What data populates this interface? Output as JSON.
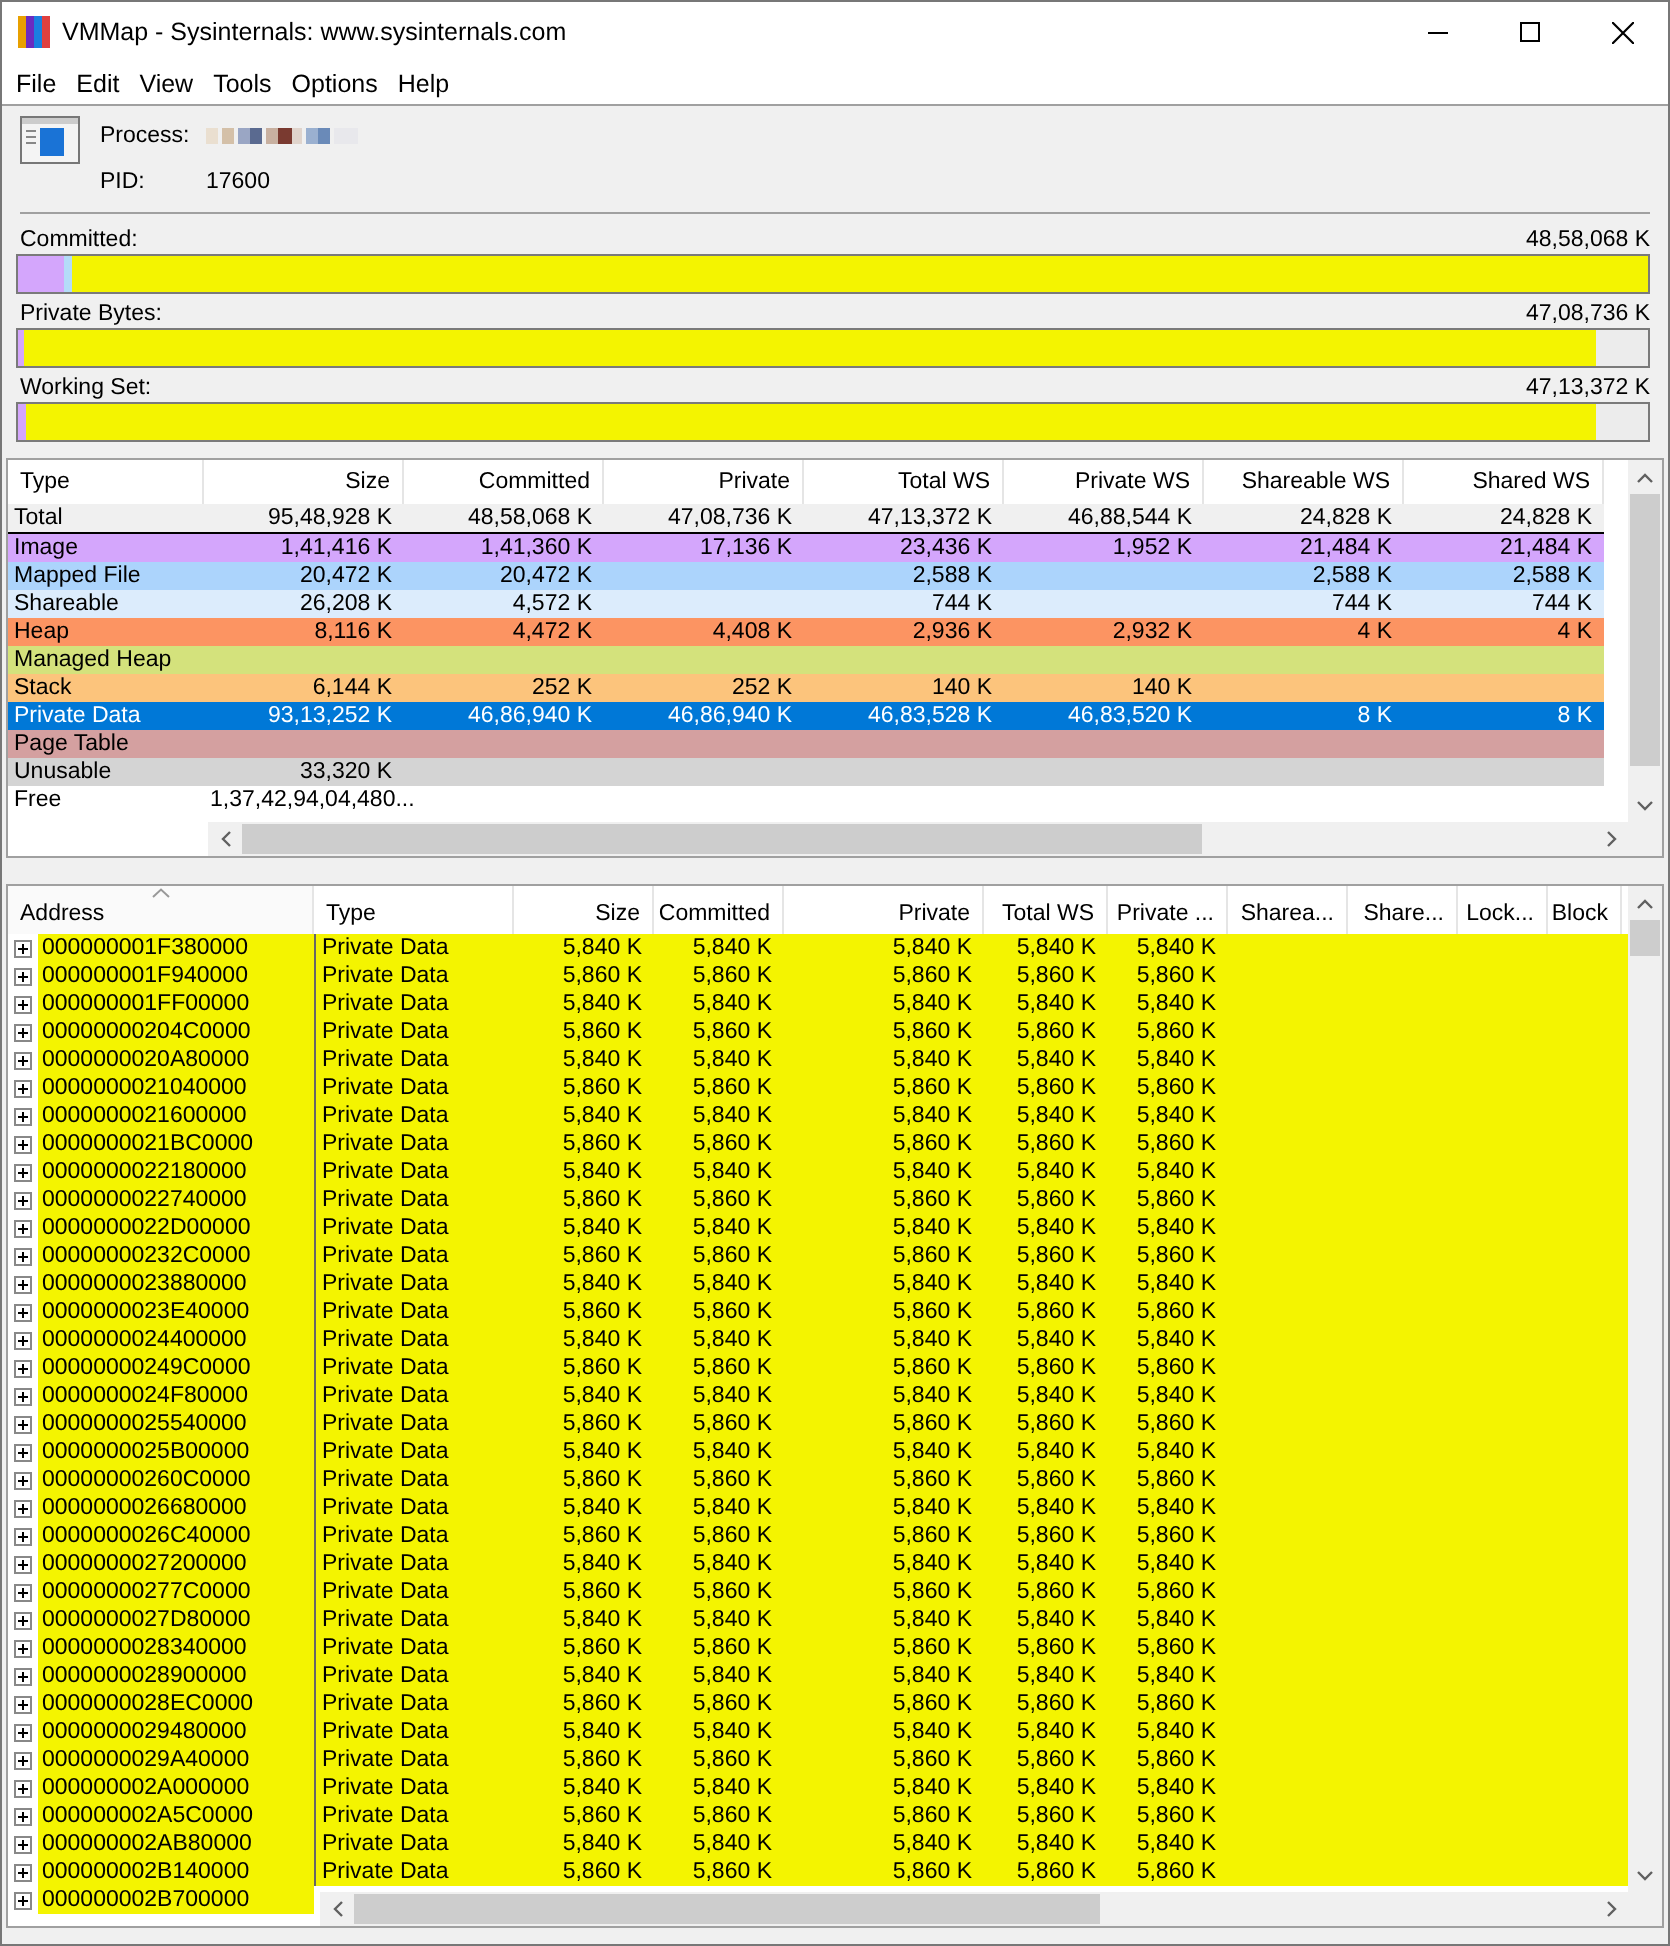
{
  "window": {
    "title": "VMMap - Sysinternals: www.sysinternals.com"
  },
  "menu": [
    "File",
    "Edit",
    "View",
    "Tools",
    "Options",
    "Help"
  ],
  "process": {
    "process_label": "Process:",
    "pid_label": "PID:",
    "pid": "17600"
  },
  "meters": [
    {
      "label": "Committed:",
      "value": "48,58,068 K",
      "segments": [
        {
          "color": "#d4a6fc",
          "level": 0.028
        },
        {
          "color": "#b4dcf8",
          "level": 0.005
        },
        {
          "color": "#f4f400",
          "level": 0.967
        }
      ]
    },
    {
      "label": "Private Bytes:",
      "value": "47,08,736 K",
      "segments": [
        {
          "color": "#d4a6fc",
          "level": 0.004
        },
        {
          "color": "#f4f400",
          "level": 0.964
        }
      ]
    },
    {
      "label": "Working Set:",
      "value": "47,13,372 K",
      "segments": [
        {
          "color": "#d4a6fc",
          "level": 0.005
        },
        {
          "color": "#f4f400",
          "level": 0.963
        }
      ]
    }
  ],
  "summary_table": {
    "columns": [
      "Type",
      "Size",
      "Committed",
      "Private",
      "Total WS",
      "Private WS",
      "Shareable WS",
      "Shared WS"
    ],
    "rows": [
      {
        "kind": "total",
        "type": "Total",
        "selected": false,
        "size": "95,48,928 K",
        "committed": "48,58,068 K",
        "private": "47,08,736 K",
        "total_ws": "47,13,372 K",
        "private_ws": "46,88,544 K",
        "shareable_ws": "24,828 K",
        "shared_ws": "24,828 K"
      },
      {
        "kind": "type",
        "type": "Image",
        "color": "#d4a6fc",
        "selected": false,
        "size": "1,41,416 K",
        "committed": "1,41,360 K",
        "private": "17,136 K",
        "total_ws": "23,436 K",
        "private_ws": "1,952 K",
        "shareable_ws": "21,484 K",
        "shared_ws": "21,484 K"
      },
      {
        "kind": "type",
        "type": "Mapped File",
        "color": "#acd4fc",
        "selected": false,
        "size": "20,472 K",
        "committed": "20,472 K",
        "total_ws": "2,588 K",
        "shareable_ws": "2,588 K",
        "shared_ws": "2,588 K"
      },
      {
        "kind": "type",
        "type": "Shareable",
        "color": "#dcecfc",
        "selected": false,
        "size": "26,208 K",
        "committed": "4,572 K",
        "total_ws": "744 K",
        "shareable_ws": "744 K",
        "shared_ws": "744 K"
      },
      {
        "kind": "type",
        "type": "Heap",
        "color": "#fc9462",
        "selected": false,
        "size": "8,116 K",
        "committed": "4,472 K",
        "private": "4,408 K",
        "total_ws": "2,936 K",
        "private_ws": "2,932 K",
        "shareable_ws": "4 K",
        "shared_ws": "4 K"
      },
      {
        "kind": "type",
        "type": "Managed Heap",
        "color": "#d4e27c",
        "selected": false
      },
      {
        "kind": "type",
        "type": "Stack",
        "color": "#fcc47c",
        "selected": false,
        "size": "6,144 K",
        "committed": "252 K",
        "private": "252 K",
        "total_ws": "140 K",
        "private_ws": "140 K"
      },
      {
        "kind": "type",
        "type": "Private Data",
        "selected": true,
        "size": "93,13,252 K",
        "committed": "46,86,940 K",
        "private": "46,86,940 K",
        "total_ws": "46,83,528 K",
        "private_ws": "46,83,520 K",
        "shareable_ws": "8 K",
        "shared_ws": "8 K"
      },
      {
        "kind": "type",
        "type": "Page Table",
        "color": "#d4a0a0",
        "selected": false
      },
      {
        "kind": "type",
        "type": "Unusable",
        "color": "#d4d4d4",
        "selected": false,
        "size": "33,320 K"
      },
      {
        "kind": "free",
        "type": "Free",
        "selected": false,
        "size": "1,37,42,94,04,480..."
      }
    ]
  },
  "detail_table": {
    "columns": [
      {
        "label": "Address",
        "sorted": true
      },
      {
        "label": "Type",
        "sorted": false
      },
      {
        "label": "Size",
        "sorted": false
      },
      {
        "label": "Committed",
        "sorted": false
      },
      {
        "label": "Private",
        "sorted": false
      },
      {
        "label": "Total WS",
        "sorted": false
      },
      {
        "label": "Private ...",
        "sorted": false
      },
      {
        "label": "Sharea...",
        "sorted": false
      },
      {
        "label": "Share...",
        "sorted": false
      },
      {
        "label": "Lock...",
        "sorted": false
      },
      {
        "label": "Block",
        "sorted": false
      }
    ],
    "rows": [
      {
        "address": "000000001F380000",
        "expanded": false,
        "type": "Private Data",
        "values": [
          "5,840 K",
          "5,840 K",
          "5,840 K",
          "5,840 K",
          "5,840 K"
        ]
      },
      {
        "address": "000000001F940000",
        "expanded": false,
        "type": "Private Data",
        "values": [
          "5,860 K",
          "5,860 K",
          "5,860 K",
          "5,860 K",
          "5,860 K"
        ]
      },
      {
        "address": "000000001FF00000",
        "expanded": false,
        "type": "Private Data",
        "values": [
          "5,840 K",
          "5,840 K",
          "5,840 K",
          "5,840 K",
          "5,840 K"
        ]
      },
      {
        "address": "00000000204C0000",
        "expanded": false,
        "type": "Private Data",
        "values": [
          "5,860 K",
          "5,860 K",
          "5,860 K",
          "5,860 K",
          "5,860 K"
        ]
      },
      {
        "address": "0000000020A80000",
        "expanded": false,
        "type": "Private Data",
        "values": [
          "5,840 K",
          "5,840 K",
          "5,840 K",
          "5,840 K",
          "5,840 K"
        ]
      },
      {
        "address": "0000000021040000",
        "expanded": false,
        "type": "Private Data",
        "values": [
          "5,860 K",
          "5,860 K",
          "5,860 K",
          "5,860 K",
          "5,860 K"
        ]
      },
      {
        "address": "0000000021600000",
        "expanded": false,
        "type": "Private Data",
        "values": [
          "5,840 K",
          "5,840 K",
          "5,840 K",
          "5,840 K",
          "5,840 K"
        ]
      },
      {
        "address": "0000000021BC0000",
        "expanded": false,
        "type": "Private Data",
        "values": [
          "5,860 K",
          "5,860 K",
          "5,860 K",
          "5,860 K",
          "5,860 K"
        ]
      },
      {
        "address": "0000000022180000",
        "expanded": false,
        "type": "Private Data",
        "values": [
          "5,840 K",
          "5,840 K",
          "5,840 K",
          "5,840 K",
          "5,840 K"
        ]
      },
      {
        "address": "0000000022740000",
        "expanded": false,
        "type": "Private Data",
        "values": [
          "5,860 K",
          "5,860 K",
          "5,860 K",
          "5,860 K",
          "5,860 K"
        ]
      },
      {
        "address": "0000000022D00000",
        "expanded": false,
        "type": "Private Data",
        "values": [
          "5,840 K",
          "5,840 K",
          "5,840 K",
          "5,840 K",
          "5,840 K"
        ]
      },
      {
        "address": "00000000232C0000",
        "expanded": false,
        "type": "Private Data",
        "values": [
          "5,860 K",
          "5,860 K",
          "5,860 K",
          "5,860 K",
          "5,860 K"
        ]
      },
      {
        "address": "0000000023880000",
        "expanded": false,
        "type": "Private Data",
        "values": [
          "5,840 K",
          "5,840 K",
          "5,840 K",
          "5,840 K",
          "5,840 K"
        ]
      },
      {
        "address": "0000000023E40000",
        "expanded": false,
        "type": "Private Data",
        "values": [
          "5,860 K",
          "5,860 K",
          "5,860 K",
          "5,860 K",
          "5,860 K"
        ]
      },
      {
        "address": "0000000024400000",
        "expanded": false,
        "type": "Private Data",
        "values": [
          "5,840 K",
          "5,840 K",
          "5,840 K",
          "5,840 K",
          "5,840 K"
        ]
      },
      {
        "address": "00000000249C0000",
        "expanded": false,
        "type": "Private Data",
        "values": [
          "5,860 K",
          "5,860 K",
          "5,860 K",
          "5,860 K",
          "5,860 K"
        ]
      },
      {
        "address": "0000000024F80000",
        "expanded": false,
        "type": "Private Data",
        "values": [
          "5,840 K",
          "5,840 K",
          "5,840 K",
          "5,840 K",
          "5,840 K"
        ]
      },
      {
        "address": "0000000025540000",
        "expanded": false,
        "type": "Private Data",
        "values": [
          "5,860 K",
          "5,860 K",
          "5,860 K",
          "5,860 K",
          "5,860 K"
        ]
      },
      {
        "address": "0000000025B00000",
        "expanded": false,
        "type": "Private Data",
        "values": [
          "5,840 K",
          "5,840 K",
          "5,840 K",
          "5,840 K",
          "5,840 K"
        ]
      },
      {
        "address": "00000000260C0000",
        "expanded": false,
        "type": "Private Data",
        "values": [
          "5,860 K",
          "5,860 K",
          "5,860 K",
          "5,860 K",
          "5,860 K"
        ]
      },
      {
        "address": "0000000026680000",
        "expanded": false,
        "type": "Private Data",
        "values": [
          "5,840 K",
          "5,840 K",
          "5,840 K",
          "5,840 K",
          "5,840 K"
        ]
      },
      {
        "address": "0000000026C40000",
        "expanded": false,
        "type": "Private Data",
        "values": [
          "5,860 K",
          "5,860 K",
          "5,860 K",
          "5,860 K",
          "5,860 K"
        ]
      },
      {
        "address": "0000000027200000",
        "expanded": false,
        "type": "Private Data",
        "values": [
          "5,840 K",
          "5,840 K",
          "5,840 K",
          "5,840 K",
          "5,840 K"
        ]
      },
      {
        "address": "00000000277C0000",
        "expanded": false,
        "type": "Private Data",
        "values": [
          "5,860 K",
          "5,860 K",
          "5,860 K",
          "5,860 K",
          "5,860 K"
        ]
      },
      {
        "address": "0000000027D80000",
        "expanded": false,
        "type": "Private Data",
        "values": [
          "5,840 K",
          "5,840 K",
          "5,840 K",
          "5,840 K",
          "5,840 K"
        ]
      },
      {
        "address": "0000000028340000",
        "expanded": false,
        "type": "Private Data",
        "values": [
          "5,860 K",
          "5,860 K",
          "5,860 K",
          "5,860 K",
          "5,860 K"
        ]
      },
      {
        "address": "0000000028900000",
        "expanded": false,
        "type": "Private Data",
        "values": [
          "5,840 K",
          "5,840 K",
          "5,840 K",
          "5,840 K",
          "5,840 K"
        ]
      },
      {
        "address": "0000000028EC0000",
        "expanded": false,
        "type": "Private Data",
        "values": [
          "5,860 K",
          "5,860 K",
          "5,860 K",
          "5,860 K",
          "5,860 K"
        ]
      },
      {
        "address": "0000000029480000",
        "expanded": false,
        "type": "Private Data",
        "values": [
          "5,840 K",
          "5,840 K",
          "5,840 K",
          "5,840 K",
          "5,840 K"
        ]
      },
      {
        "address": "0000000029A40000",
        "expanded": false,
        "type": "Private Data",
        "values": [
          "5,860 K",
          "5,860 K",
          "5,860 K",
          "5,860 K",
          "5,860 K"
        ]
      },
      {
        "address": "000000002A000000",
        "expanded": false,
        "type": "Private Data",
        "values": [
          "5,840 K",
          "5,840 K",
          "5,840 K",
          "5,840 K",
          "5,840 K"
        ]
      },
      {
        "address": "000000002A5C0000",
        "expanded": false,
        "type": "Private Data",
        "values": [
          "5,860 K",
          "5,860 K",
          "5,860 K",
          "5,860 K",
          "5,860 K"
        ]
      },
      {
        "address": "000000002AB80000",
        "expanded": false,
        "type": "Private Data",
        "values": [
          "5,840 K",
          "5,840 K",
          "5,840 K",
          "5,840 K",
          "5,840 K"
        ]
      },
      {
        "address": "000000002B140000",
        "expanded": false,
        "type": "Private Data",
        "values": [
          "5,860 K",
          "5,860 K",
          "5,860 K",
          "5,860 K",
          "5,860 K"
        ]
      },
      {
        "address": "000000002B700000",
        "expanded": false
      }
    ]
  }
}
